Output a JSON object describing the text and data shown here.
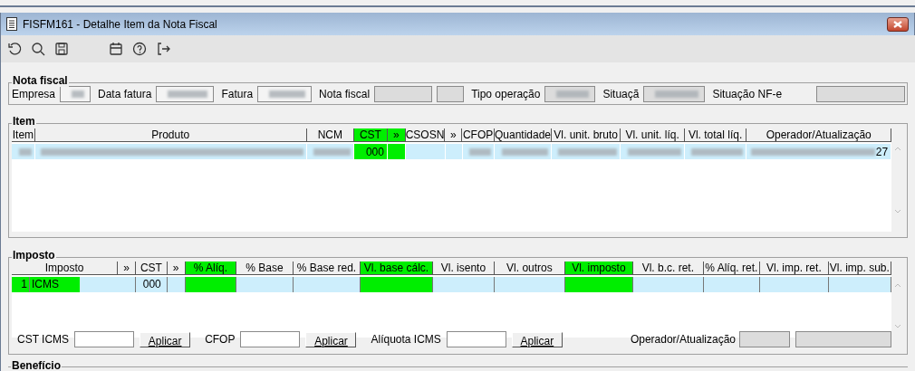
{
  "window": {
    "title": "FISFM161 - Detalhe Item da Nota Fiscal"
  },
  "toolbar": [
    {
      "kind": "undo"
    },
    {
      "kind": "search"
    },
    {
      "kind": "save"
    },
    {
      "kind": "calendar"
    },
    {
      "kind": "help"
    },
    {
      "kind": "exit"
    }
  ],
  "nota_fiscal": {
    "title": "Nota fiscal",
    "fields": [
      {
        "label": "Empresa",
        "blurred": true,
        "disabled": false
      },
      {
        "label": "Data fatura",
        "blurred": true,
        "disabled": false
      },
      {
        "label": "Fatura",
        "blurred": true,
        "disabled": false
      },
      {
        "label": "Nota fiscal",
        "blurred": false,
        "disabled": true
      },
      {
        "label": "Tipo operação",
        "blurred": true,
        "disabled": true
      },
      {
        "label": "Situaçã",
        "blurred": true,
        "disabled": true
      },
      {
        "label": "Situação NF-e",
        "blurred": false,
        "disabled": true
      }
    ]
  },
  "item": {
    "title": "Item",
    "columns": [
      {
        "label": "Item",
        "highlighted": false
      },
      {
        "label": "Produto",
        "highlighted": false
      },
      {
        "label": "NCM",
        "highlighted": false
      },
      {
        "label": "CST",
        "highlighted": true
      },
      {
        "label": "»",
        "highlighted": true
      },
      {
        "label": "CSOSN",
        "highlighted": false
      },
      {
        "label": "»",
        "highlighted": false
      },
      {
        "label": "CFOP",
        "highlighted": false
      },
      {
        "label": "Quantidade",
        "highlighted": false
      },
      {
        "label": "Vl. unit. bruto",
        "highlighted": false
      },
      {
        "label": "Vl. unit. líq.",
        "highlighted": false
      },
      {
        "label": "Vl. total líq.",
        "highlighted": false
      },
      {
        "label": "Operador/Atualização",
        "highlighted": false
      }
    ],
    "rows": [
      {
        "cells": [
          {
            "blurred": true
          },
          {
            "blurred": true
          },
          {
            "blurred": true
          },
          {
            "text": "000",
            "blurred": false
          },
          {
            "blurred": false
          },
          {
            "blurred": false
          },
          {
            "blurred": false
          },
          {
            "blurred": true
          },
          {
            "blurred": true
          },
          {
            "blurred": true
          },
          {
            "blurred": true
          },
          {
            "blurred": true
          },
          {
            "text": "27",
            "blurred": true
          }
        ]
      }
    ]
  },
  "imposto": {
    "title": "Imposto",
    "columns": [
      {
        "label": "Imposto",
        "highlighted": false
      },
      {
        "label": "»",
        "highlighted": false
      },
      {
        "label": "CST",
        "highlighted": false
      },
      {
        "label": "»",
        "highlighted": false
      },
      {
        "label": "% Alíq.",
        "highlighted": true
      },
      {
        "label": "% Base",
        "highlighted": false
      },
      {
        "label": "% Base red.",
        "highlighted": false
      },
      {
        "label": "Vl. base cálc.",
        "highlighted": true
      },
      {
        "label": "Vl. isento",
        "highlighted": false
      },
      {
        "label": "Vl. outros",
        "highlighted": false
      },
      {
        "label": "Vl. imposto",
        "highlighted": true
      },
      {
        "label": "Vl. b.c. ret.",
        "highlighted": false
      },
      {
        "label": "% Alíq. ret.",
        "highlighted": false
      },
      {
        "label": "Vl. imp. ret.",
        "highlighted": false
      },
      {
        "label": "Vl. imp. sub.",
        "highlighted": false
      }
    ],
    "rows": [
      {
        "number": "1",
        "name": "ICMS",
        "highlighted": true,
        "cells": [
          "",
          "",
          "000",
          "",
          "",
          "",
          "",
          "",
          "",
          "",
          "",
          "",
          "",
          "",
          ""
        ]
      }
    ],
    "apply_fields": [
      {
        "label": "CST ICMS",
        "button": "Aplicar"
      },
      {
        "label": "CFOP",
        "button": "Aplicar"
      },
      {
        "label": "Alíquota ICMS",
        "button": "Aplicar"
      }
    ],
    "operator_label": "Operador/Atualização"
  },
  "beneficio": {
    "title": "Benefício"
  }
}
